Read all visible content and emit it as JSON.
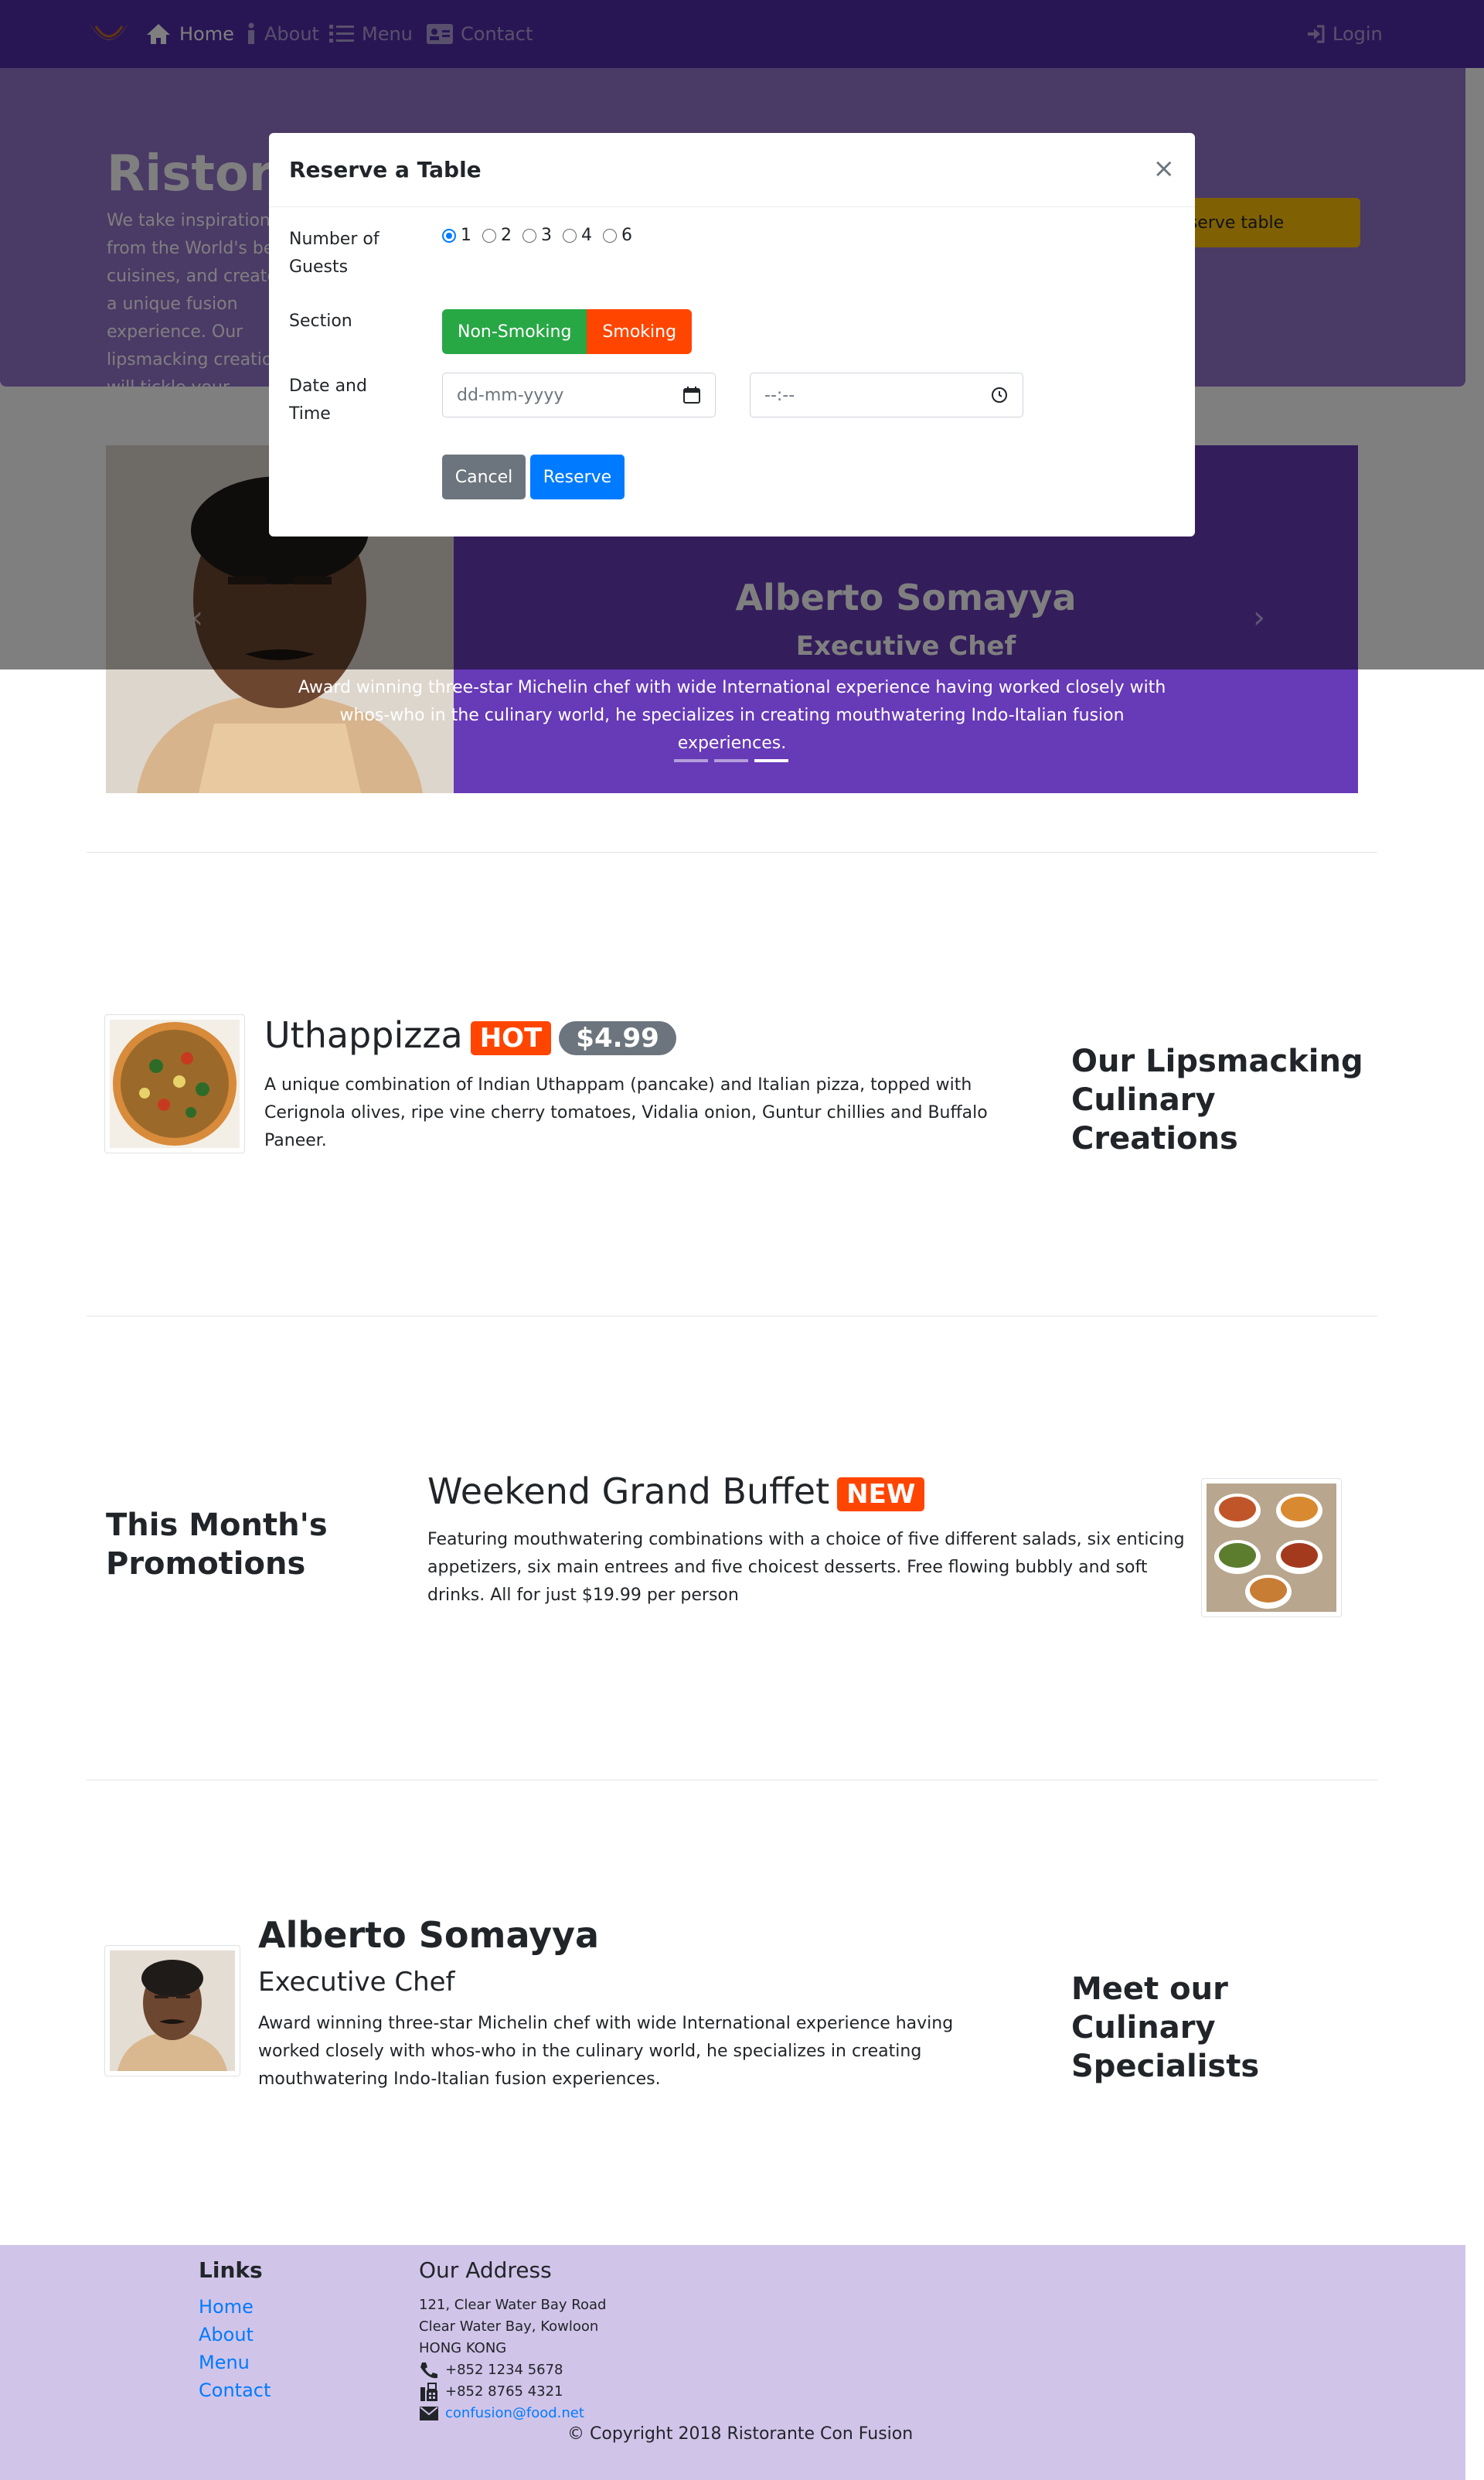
{
  "nav": {
    "items": [
      {
        "label": "Home",
        "icon": "home-icon"
      },
      {
        "label": "About",
        "icon": "info-icon"
      },
      {
        "label": "Menu",
        "icon": "list-icon"
      },
      {
        "label": "Contact",
        "icon": "address-card-icon"
      }
    ],
    "login": "Login"
  },
  "jumbotron": {
    "title": "Ristorante con Fusion",
    "text": "We take inspiration from the World's best cuisines, and create a unique fusion experience. Our lipsmacking creations will tickle your culinary senses!",
    "reserve_button": "Reserve table"
  },
  "carousel": {
    "name": "Alberto Somayya",
    "designation": "Executive Chef",
    "caption": "Award winning three-star Michelin chef with wide International experience having worked closely with whos-who in the culinary world, he specializes in creating mouthwatering Indo-Italian fusion experiences.",
    "active_index": 2
  },
  "modal": {
    "title": "Reserve a Table",
    "close": "×",
    "guests_label": "Number of Guests",
    "guests_options": [
      "1",
      "2",
      "3",
      "4",
      "6"
    ],
    "guests_selected": "1",
    "section_label": "Section",
    "section_options": [
      "Non-Smoking",
      "Smoking"
    ],
    "datetime_label": "Date and Time",
    "date_placeholder": "dd-mm-yyyy",
    "time_placeholder": "--:--",
    "cancel": "Cancel",
    "reserve": "Reserve"
  },
  "dish": {
    "name": "Uthappizza",
    "badge": "HOT",
    "price": "$4.99",
    "description": "A unique combination of Indian Uthappam (pancake) and Italian pizza, topped with Cerignola olives, ripe vine cherry tomatoes, Vidalia onion, Guntur chillies and Buffalo Paneer.",
    "side_heading": "Our Lipsmacking Culinary Creations"
  },
  "promotion": {
    "name": "Weekend Grand Buffet",
    "badge": "NEW",
    "description": "Featuring mouthwatering combinations with a choice of five different salads, six enticing appetizers, six main entrees and five choicest desserts. Free flowing bubbly and soft drinks. All for just $19.99 per person",
    "side_heading": "This Month's Promotions"
  },
  "leader": {
    "name": "Alberto Somayya",
    "designation": "Executive Chef",
    "description": "Award winning three-star Michelin chef with wide International experience having worked closely with whos-who in the culinary world, he specializes in creating mouthwatering Indo-Italian fusion experiences.",
    "side_heading": "Meet our Culinary Specialists"
  },
  "footer": {
    "links_heading": "Links",
    "links": [
      "Home",
      "About",
      "Menu",
      "Contact"
    ],
    "address_heading": "Our Address",
    "address_lines": [
      "121, Clear Water Bay Road",
      "Clear Water Bay, Kowloon",
      "HONG KONG"
    ],
    "phone": "+852 1234 5678",
    "fax": "+852 8765 4321",
    "email": "confusion@food.net",
    "copyright": "© Copyright 2018 Ristorante Con Fusion"
  },
  "colors": {
    "primary": "#512DA8",
    "jumbotron": "#9575CD",
    "footer": "#D1C4E9",
    "hot": "#FF4500",
    "success": "#28a745",
    "blue": "#007bff",
    "warning": "#FFC107"
  }
}
